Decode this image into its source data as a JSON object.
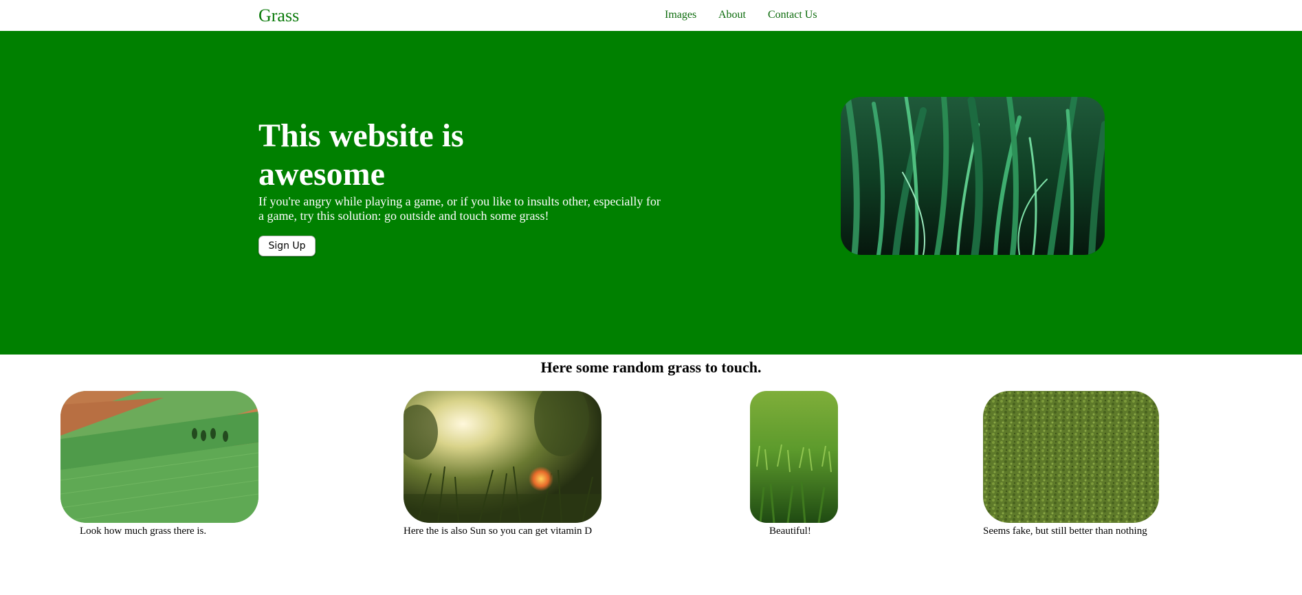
{
  "nav": {
    "brand": "Grass",
    "links": [
      "Images",
      "About",
      "Contact Us"
    ]
  },
  "hero": {
    "title": "This website is awesome",
    "text": "If you're angry while playing a game, or if you like to insults other, especially for a game, try this solution: go outside and touch some grass!",
    "button_label": "Sign Up"
  },
  "gallery": {
    "title": "Here some random grass to touch.",
    "items": [
      {
        "caption": "Look how much grass there is."
      },
      {
        "caption": "Here the is also Sun so you can get vitamin D"
      },
      {
        "caption": "Beautiful!"
      },
      {
        "caption": "Seems fake, but still better than nothing"
      }
    ]
  },
  "colors": {
    "brand_green": "#008000",
    "link_green": "#0a6a0a"
  }
}
